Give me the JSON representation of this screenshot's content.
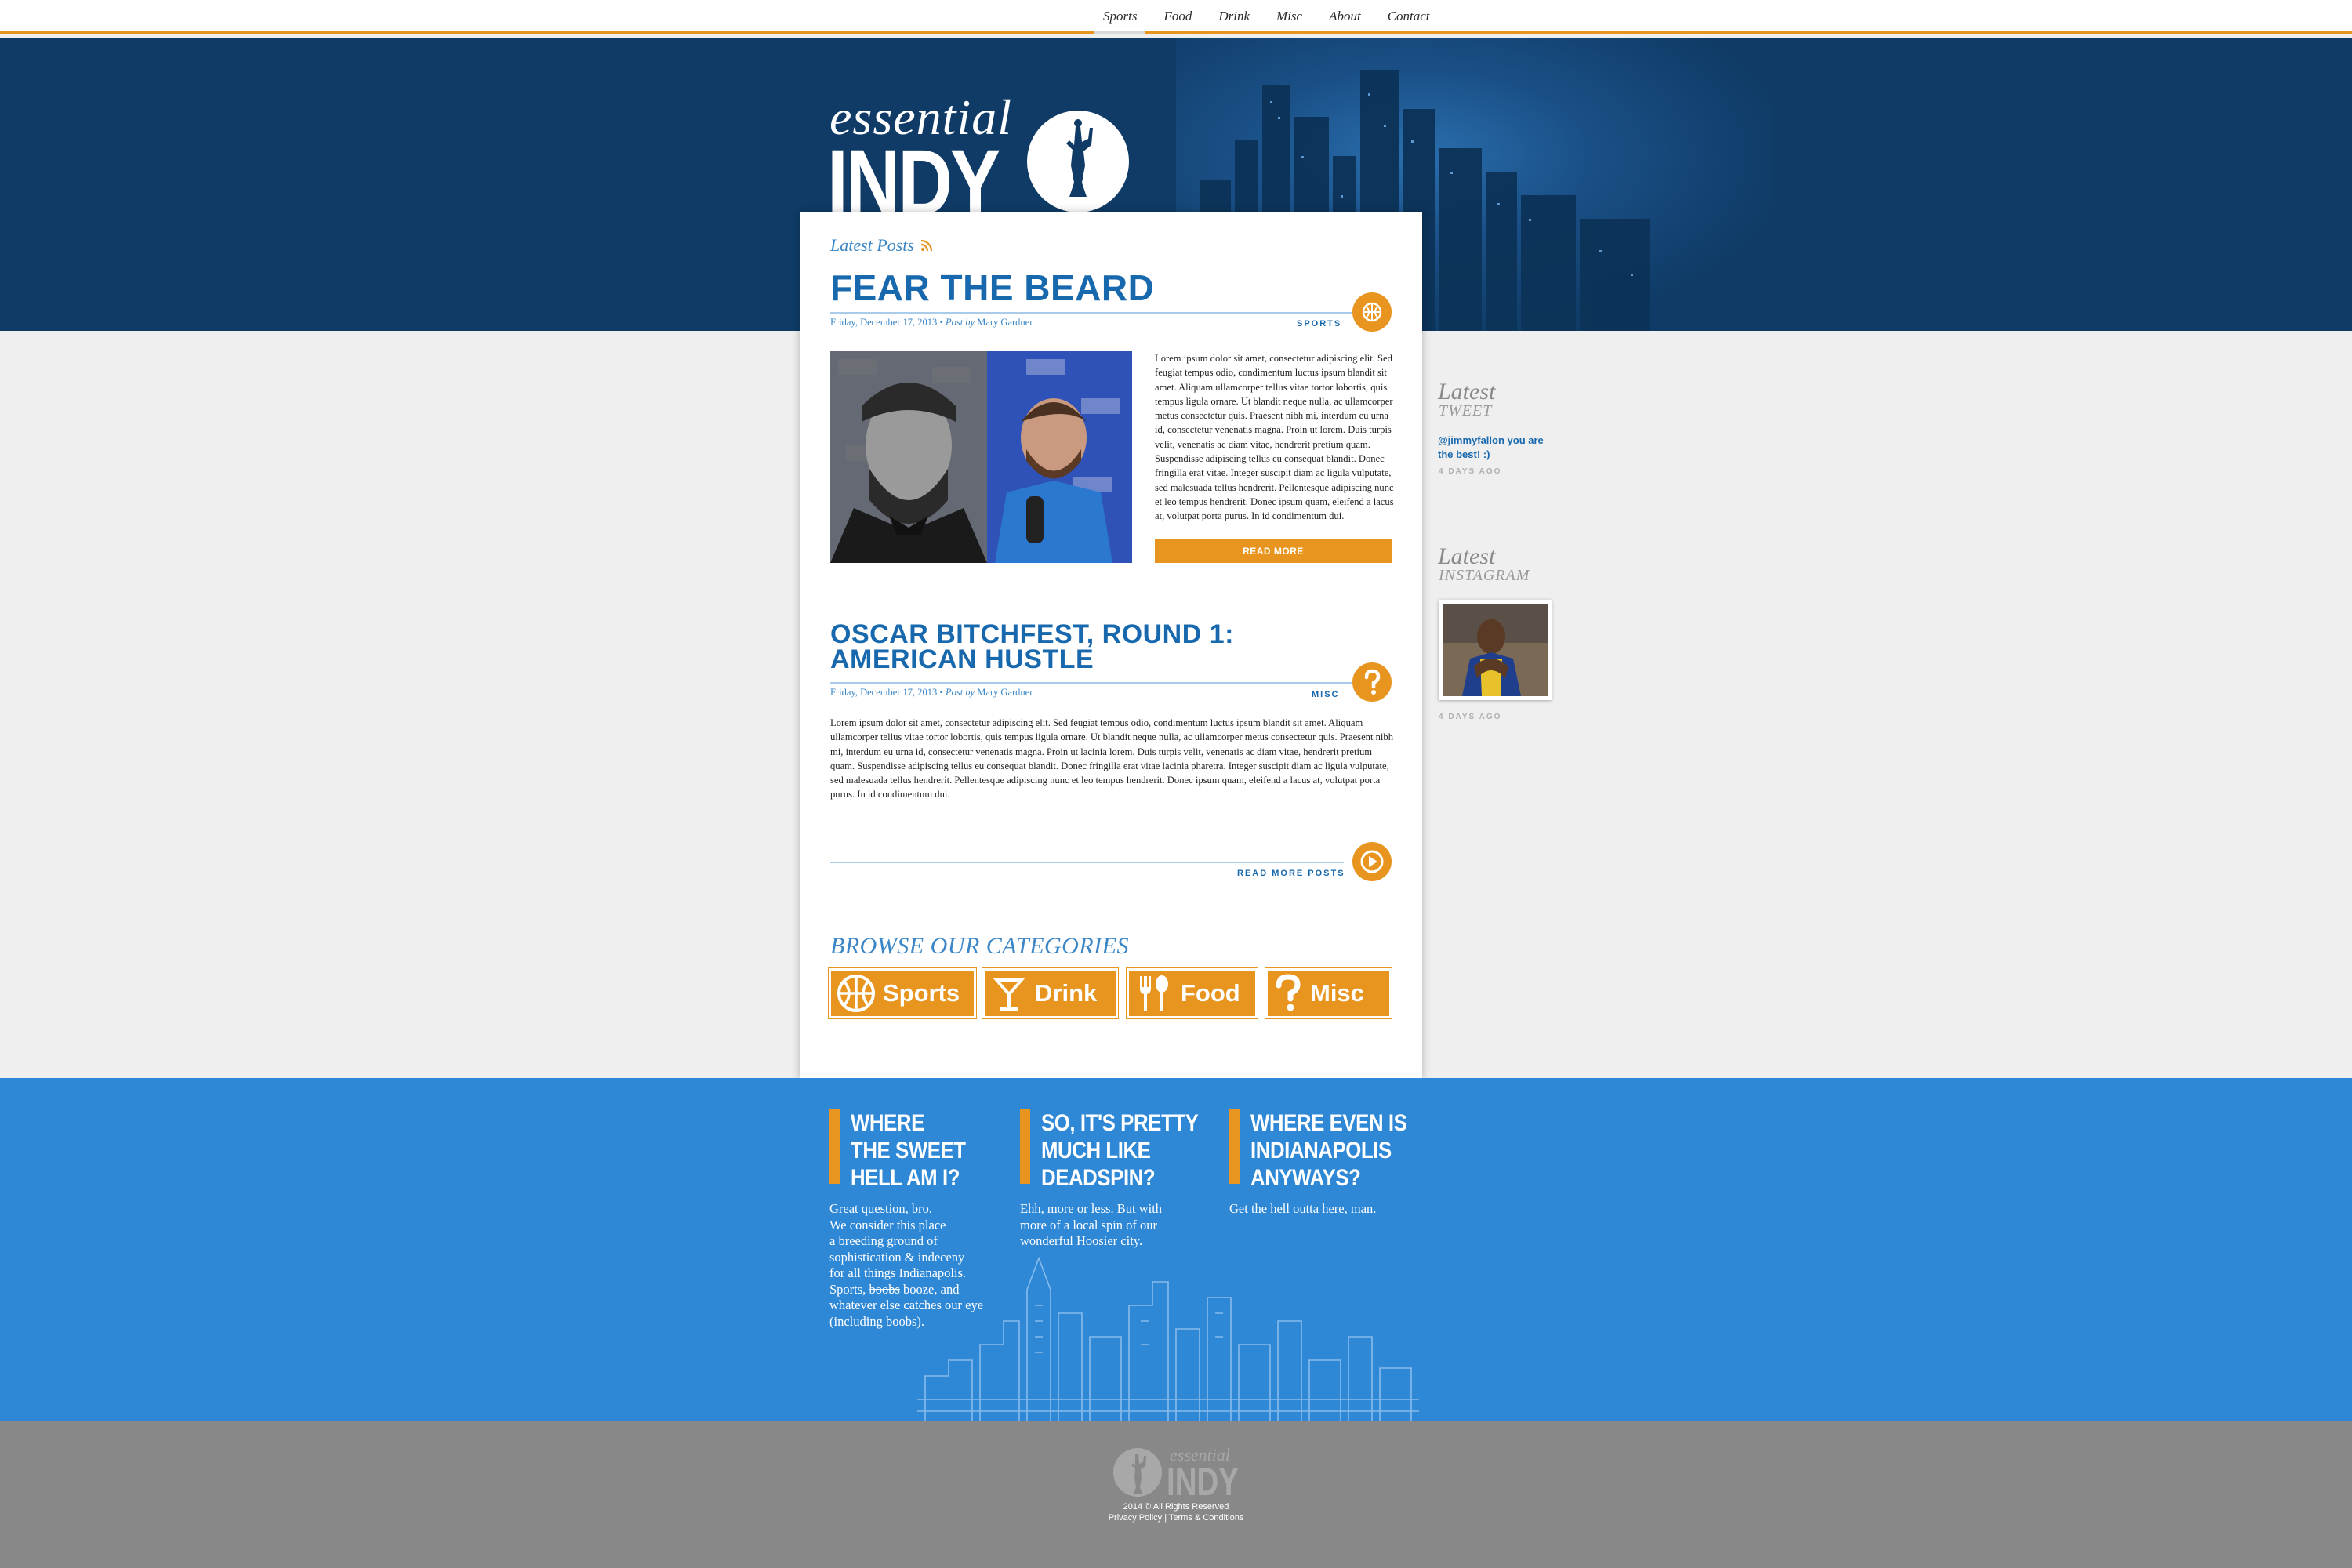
{
  "nav": {
    "items": [
      "Sports",
      "Food",
      "Drink",
      "Misc",
      "About",
      "Contact"
    ],
    "active": "Sports"
  },
  "logo": {
    "line1": "essential",
    "line2": "INDY"
  },
  "main": {
    "latest_posts_label": "Latest Posts",
    "posts": [
      {
        "title": "FEAR THE BEARD",
        "date": "Friday, December 17, 2013",
        "author_prefix": "Post by",
        "author": "Mary Gardner",
        "category": "SPORTS",
        "category_icon": "basketball-icon",
        "body": "Lorem ipsum dolor sit amet, consectetur adipiscing elit. Sed feugiat tempus odio, condimentum luctus ipsum blandit sit amet. Aliquam ullamcorper tellus vitae tortor lobortis, quis tempus ligula ornare. Ut blandit neque nulla, ac ullamcorper metus consectetur quis. Praesent nibh mi, interdum eu urna id, consectetur venenatis magna. Proin ut lorem. Duis turpis velit, venenatis ac diam vitae, hendrerit pretium quam. Suspendisse adipiscing tellus eu consequat blandit. Donec fringilla erat vitae. Integer suscipit diam ac ligula vulputate, sed malesuada tellus hendrerit. Pellentesque adipiscing nunc et leo tempus hendrerit. Donec ipsum quam, eleifend a lacus at, volutpat porta purus. In id condimentum dui.",
        "read_more": "READ MORE"
      },
      {
        "title_line1": "OSCAR BITCHFEST, ROUND 1:",
        "title_line2": "AMERICAN HUSTLE",
        "date": "Friday, December 17, 2013",
        "author_prefix": "Post by",
        "author": "Mary Gardner",
        "category": "MISC",
        "category_icon": "question-icon",
        "body": "Lorem ipsum dolor sit amet, consectetur adipiscing elit. Sed feugiat tempus odio, condimentum luctus ipsum blandit sit amet. Aliquam ullamcorper tellus vitae tortor lobortis, quis tempus ligula ornare. Ut blandit neque nulla, ac ullamcorper metus consectetur quis. Praesent nibh mi, interdum eu urna id, consectetur venenatis magna. Proin ut lacinia lorem. Duis turpis velit, venenatis ac diam vitae, hendrerit pretium quam. Suspendisse adipiscing tellus eu consequat blandit. Donec fringilla erat vitae lacinia pharetra. Integer suscipit diam ac ligula vulputate, sed malesuada tellus hendrerit. Pellentesque adipiscing nunc et leo tempus hendrerit. Donec ipsum quam, eleifend a lacus at, volutpat porta purus. In id condimentum dui."
      }
    ],
    "read_more_posts": "READ MORE POSTS",
    "browse_heading": "BROWSE OUR CATEGORIES",
    "categories": [
      {
        "label": "Sports",
        "icon": "basketball-icon"
      },
      {
        "label": "Drink",
        "icon": "cocktail-icon"
      },
      {
        "label": "Food",
        "icon": "utensils-icon"
      },
      {
        "label": "Misc",
        "icon": "question-icon"
      }
    ]
  },
  "sidebar": {
    "tweet": {
      "heading1": "Latest",
      "heading2": "TWEET",
      "text": "@jimmyfallon you are the best! :)",
      "ago": "4 DAYS AGO"
    },
    "instagram": {
      "heading1": "Latest",
      "heading2": "INSTAGRAM",
      "ago": "4 DAYS AGO"
    }
  },
  "about": {
    "columns": [
      {
        "heading": "WHERE\nTHE SWEET\nHELL AM I?",
        "text_before": "Great question, bro.\nWe consider this place\na breeding ground of\nsophistication & indeceny\nfor all things Indianapolis.\nSports, ",
        "text_struck": "boobs",
        "text_after": " booze, and\nwhatever else catches our eye\n(including boobs)."
      },
      {
        "heading": "SO, IT'S PRETTY\nMUCH LIKE\nDEADSPIN?",
        "text": "Ehh, more or less. But with\nmore of a local spin of our\nwonderful Hoosier city."
      },
      {
        "heading": "WHERE EVEN IS\nINDIANAPOLIS\nANYWAYS?",
        "text": "Get the hell outta here, man."
      }
    ]
  },
  "footer": {
    "logo_line1": "essential",
    "logo_line2": "INDY",
    "copyright": "2014 © All Rights Reserved",
    "privacy": "Privacy Policy",
    "separator": "|",
    "terms": "Terms & Conditions"
  },
  "colors": {
    "orange": "#e8951f",
    "navy": "#0f3b66",
    "blue": "#2f88d6",
    "link_blue": "#1768ad"
  }
}
